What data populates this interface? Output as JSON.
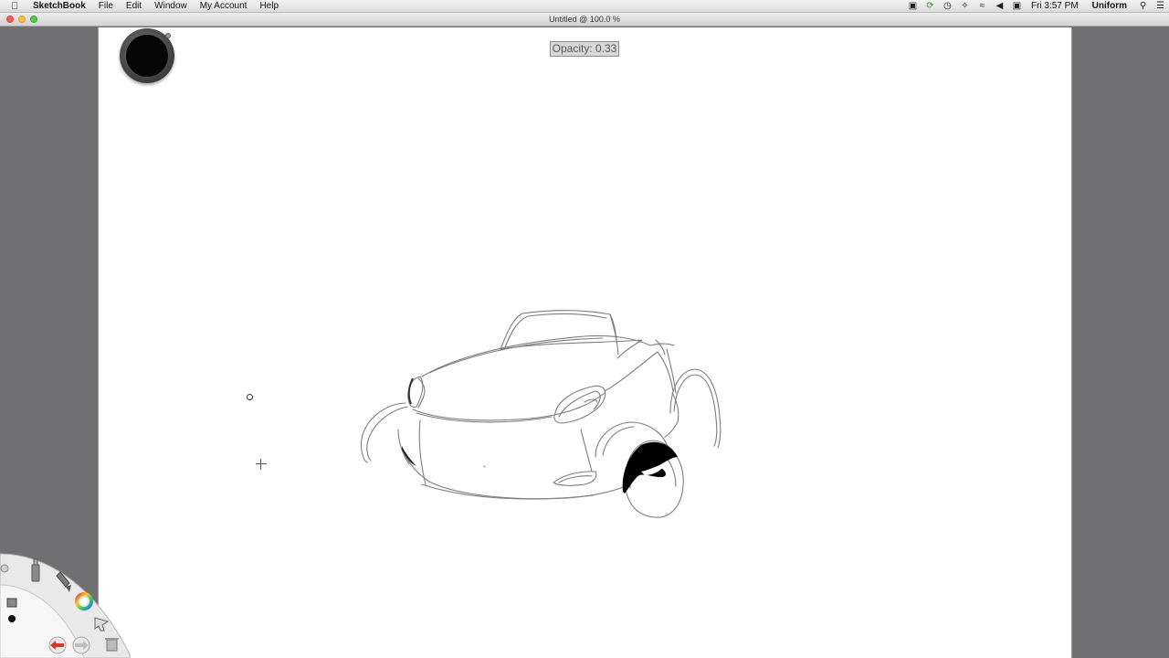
{
  "menubar": {
    "app_name": "SketchBook",
    "menus": [
      "File",
      "Edit",
      "Window",
      "My Account",
      "Help"
    ],
    "clock": "Fri 3:57 PM",
    "user": "Uniform"
  },
  "window": {
    "title": "Untitled @ 100.0 %"
  },
  "canvas": {
    "opacity_label": "Opacity: 0.33",
    "brush_color": "#000000"
  },
  "icons": {
    "apple": "apple-logo-icon",
    "status": [
      "camera-icon",
      "sync-icon",
      "time-machine-icon",
      "bluetooth-icon",
      "wifi-icon",
      "volume-icon",
      "input-menu-icon",
      "spotlight-icon",
      "notification-center-icon"
    ],
    "lagoon": [
      "brush-library-icon",
      "pencil-icon",
      "brush-icon",
      "color-wheel-icon",
      "layer-icon",
      "brush-dot-icon",
      "selection-arrow-icon",
      "undo-icon",
      "redo-icon",
      "trash-icon"
    ]
  }
}
